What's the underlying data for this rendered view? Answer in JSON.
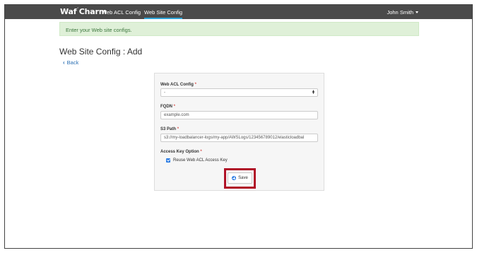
{
  "navbar": {
    "brand_left": "Waf",
    "brand_right": "Charm",
    "links": [
      {
        "label": "Web ACL Config",
        "active": false
      },
      {
        "label": "Web Site Config",
        "active": true
      }
    ],
    "user_name": "John Smith"
  },
  "alert": {
    "message": "Enter your Web site configs."
  },
  "page": {
    "title": "Web Site Config : Add",
    "back_label": "Back"
  },
  "form": {
    "web_acl_config": {
      "label": "Web ACL Config",
      "required_mark": "*",
      "selected_value": "-"
    },
    "fqdn": {
      "label": "FQDN",
      "required_mark": "*",
      "placeholder": "example.com"
    },
    "s3_path": {
      "label": "S3 Path",
      "required_mark": "*",
      "placeholder": "s3://my-loadbalancer-logs/my-app/AWSLogs/123456789012/elasticloadbal"
    },
    "access_key_option": {
      "label": "Access Key Option",
      "required_mark": "*",
      "checkbox_label": "Reuse Web ACL Access Key",
      "checked": true
    },
    "save_label": "Save"
  },
  "colors": {
    "navbar_bg": "#4a4a4a",
    "active_underline": "#2ea3d6",
    "alert_bg": "#dff0d8",
    "alert_text": "#3c763d",
    "link": "#2a6fb3",
    "highlight": "#b01227",
    "checkbox": "#2a7be4"
  }
}
